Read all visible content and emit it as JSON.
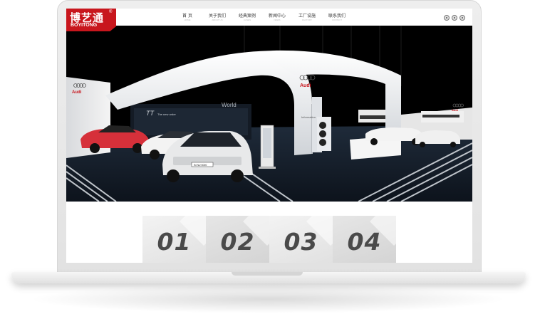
{
  "brand": {
    "name_cn": "博艺通",
    "name_en": "BOYITONG",
    "reg": "®"
  },
  "nav": [
    {
      "label": "首 页",
      "sub": "HOME"
    },
    {
      "label": "关于我们",
      "sub": "ABOUT US"
    },
    {
      "label": "经典案例",
      "sub": "CASES"
    },
    {
      "label": "新闻中心",
      "sub": "NEWS"
    },
    {
      "label": "工厂设施",
      "sub": "FACTORY"
    },
    {
      "label": "联系我们",
      "sub": "CONTACT"
    }
  ],
  "header_icons": [
    "weibo-icon",
    "wechat-icon",
    "phone-icon"
  ],
  "banner": {
    "brand_signs": [
      "Audi",
      "Audi",
      "Audi",
      "Audi"
    ],
    "wall_texts": [
      "TT",
      "The new order",
      "World",
      "Information"
    ],
    "license_plate": "IN NU 5000"
  },
  "tiles": [
    "01",
    "02",
    "03",
    "04"
  ],
  "colors": {
    "brand_red": "#c8161d",
    "banner_bg": "#000000",
    "tile_text": "#4a4a4a"
  }
}
